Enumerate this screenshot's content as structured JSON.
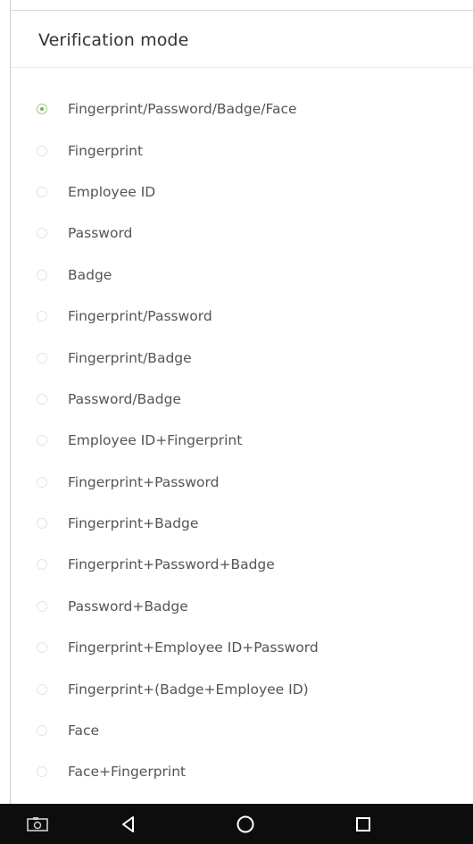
{
  "header": {
    "title": "Verification mode"
  },
  "verification_modes": [
    {
      "label": "Fingerprint/Password/Badge/Face",
      "selected": true
    },
    {
      "label": "Fingerprint",
      "selected": false
    },
    {
      "label": "Employee ID",
      "selected": false
    },
    {
      "label": "Password",
      "selected": false
    },
    {
      "label": "Badge",
      "selected": false
    },
    {
      "label": "Fingerprint/Password",
      "selected": false
    },
    {
      "label": "Fingerprint/Badge",
      "selected": false
    },
    {
      "label": "Password/Badge",
      "selected": false
    },
    {
      "label": "Employee ID+Fingerprint",
      "selected": false
    },
    {
      "label": "Fingerprint+Password",
      "selected": false
    },
    {
      "label": "Fingerprint+Badge",
      "selected": false
    },
    {
      "label": "Fingerprint+Password+Badge",
      "selected": false
    },
    {
      "label": "Password+Badge",
      "selected": false
    },
    {
      "label": "Fingerprint+Employee ID+Password",
      "selected": false
    },
    {
      "label": "Fingerprint+(Badge+Employee ID)",
      "selected": false
    },
    {
      "label": "Face",
      "selected": false
    },
    {
      "label": "Face+Fingerprint",
      "selected": false
    }
  ],
  "navbar": {
    "icons": [
      "screenshot-icon",
      "back-icon",
      "home-icon",
      "recents-icon"
    ]
  },
  "colors": {
    "selected_accent": "#6fb35a",
    "navbar_background": "#0d0d0d"
  }
}
